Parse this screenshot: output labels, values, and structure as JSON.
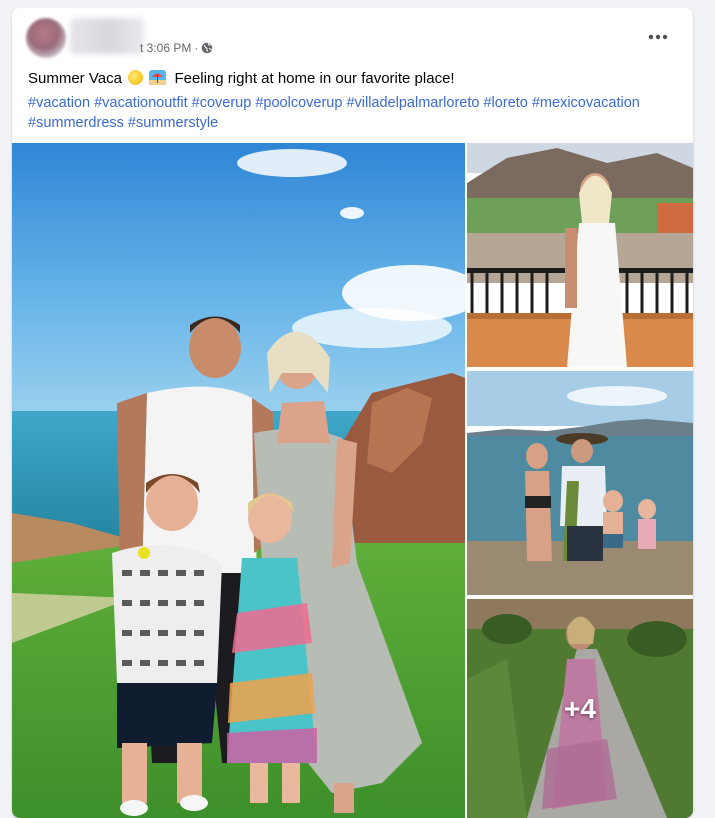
{
  "post": {
    "timestamp": "t 3:06 PM",
    "separator": "·",
    "text_part1": "Summer Vaca",
    "text_part2": "Feeling right at home in our favorite place!",
    "emojis": [
      "sun-emoji",
      "beach-umbrella-emoji"
    ],
    "hashtags": [
      "#vacation",
      "#vacationoutfit",
      "#coverup",
      "#poolcoverup",
      "#villadelpalmarloreto",
      "#loreto",
      "#mexicovacation",
      "#summerdress",
      "#summerstyle"
    ],
    "more_photos_count": "+4"
  },
  "icons": {
    "globe": "globe-icon",
    "more": "more-options-icon"
  },
  "colors": {
    "link": "#3b6ad1",
    "meta": "#65676b",
    "background": "#f0f2f5"
  }
}
